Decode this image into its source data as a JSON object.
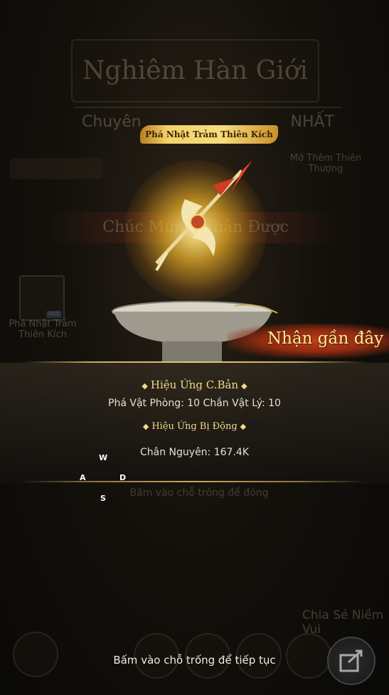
{
  "background": {
    "title": "Nghiêm Hàn Giới",
    "subtitle": "Chuyên",
    "subtitle_right": "NHẤT",
    "side_text": "Mở Thêm Thiên Thượng",
    "banner": "Chúc Mừng Nhận Được",
    "item_label": "Phá Nhật Trảm Thiên Kích",
    "item_badge": "Mới",
    "close_hint": "Bấm vào chỗ trống để đóng",
    "share_label": "Chia Sẻ Niềm Vui"
  },
  "reward": {
    "item_name": "Phá Nhật Trảm Thiên Kích",
    "recent_label": "Nhận gần đây"
  },
  "effects": {
    "basic_title": "Hiệu Ứng C.Bản",
    "basic_stats": "Phá Vật Phòng: 10 Chắn Vật Lý: 10",
    "passive_title": "Hiệu Ứng Bị Động",
    "passive_stats": "Chân Nguyên: 167.4K"
  },
  "keys": {
    "w": "W",
    "a": "A",
    "s": "S",
    "d": "D"
  },
  "footer": {
    "continue_text": "Bấm vào chỗ trống để tiếp tục"
  },
  "colors": {
    "gold": "#f2d98a",
    "recent_bg": "#c4411a"
  }
}
